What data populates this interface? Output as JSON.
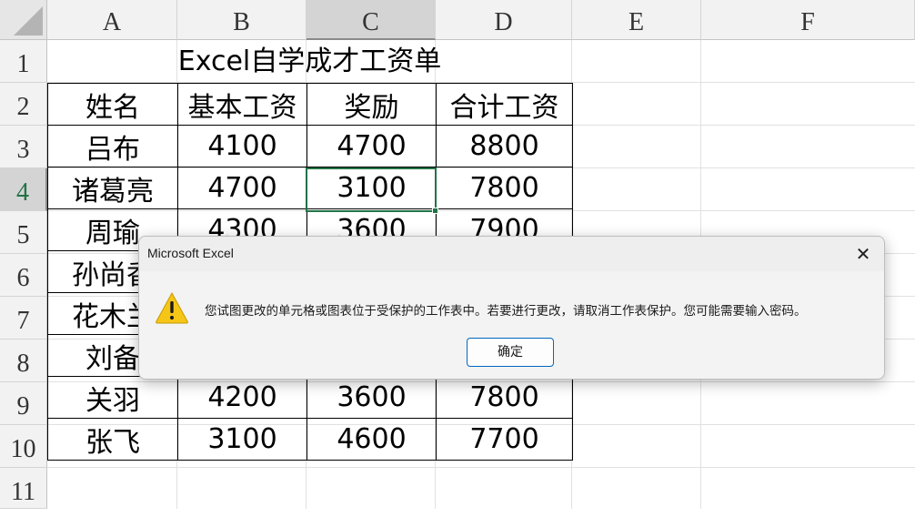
{
  "columns": [
    "A",
    "B",
    "C",
    "D",
    "E",
    "F"
  ],
  "rows": [
    "1",
    "2",
    "3",
    "4",
    "5",
    "6",
    "7",
    "8",
    "9",
    "10",
    "11"
  ],
  "title": "Excel自学成才工资单",
  "table": {
    "headers": [
      "姓名",
      "基本工资",
      "奖励",
      "合计工资"
    ],
    "body": [
      [
        "吕布",
        "4100",
        "4700",
        "8800"
      ],
      [
        "诸葛亮",
        "4700",
        "3100",
        "7800"
      ],
      [
        "周瑜",
        "4300",
        "3600",
        "7900"
      ],
      [
        "孙尚香",
        "",
        "",
        ""
      ],
      [
        "花木兰",
        "",
        "",
        ""
      ],
      [
        "刘备",
        "",
        "",
        ""
      ],
      [
        "关羽",
        "4200",
        "3600",
        "7800"
      ],
      [
        "张飞",
        "3100",
        "4600",
        "7700"
      ]
    ]
  },
  "selection": {
    "column": "C",
    "row": "4"
  },
  "colors": {
    "accent": "#217346",
    "button_border": "#0067c0",
    "warning_yellow": "#f5c518"
  },
  "dialog": {
    "title": "Microsoft Excel",
    "message": "您试图更改的单元格或图表位于受保护的工作表中。若要进行更改，请取消工作表保护。您可能需要输入密码。",
    "ok_label": "确定",
    "close_glyph": "✕",
    "icon": "warning-icon"
  }
}
